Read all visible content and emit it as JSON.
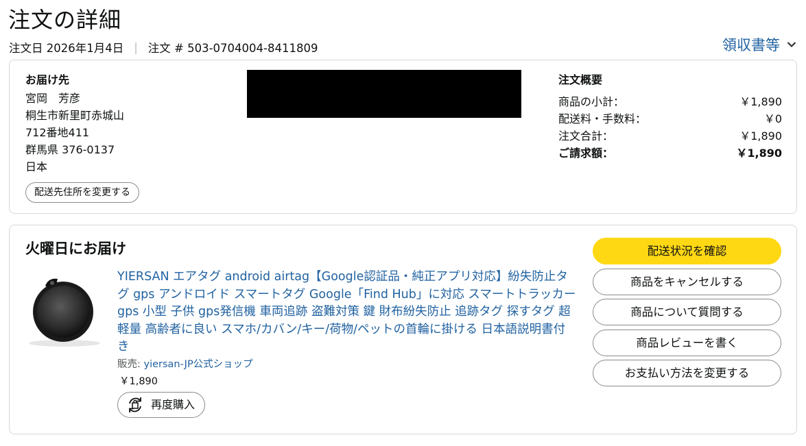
{
  "header": {
    "title": "注文の詳細",
    "order_date": "注文日 2026年1月4日",
    "separator": "|",
    "order_number": "注文 # 503-0704004-8411809",
    "receipt_link": "領収書等"
  },
  "shipping": {
    "heading": "お届け先",
    "lines": [
      "宮岡　芳彦",
      "桐生市新里町赤城山",
      "712番地411",
      "群馬県 376-0137",
      "日本"
    ],
    "change_button": "配送先住所を変更する"
  },
  "summary": {
    "heading": "注文概要",
    "rows": [
      {
        "label": "商品の小計：",
        "value": "￥1,890"
      },
      {
        "label": "配送料・手数料：",
        "value": "￥0"
      },
      {
        "label": "注文合計：",
        "value": "￥1,890"
      },
      {
        "label": "ご請求額：",
        "value": "￥1,890"
      }
    ]
  },
  "delivery": {
    "heading": "火曜日にお届け",
    "product_title": "YIERSAN エアタグ android airtag【Google認証品・純正アプリ対応】紛失防止タグ gps アンドロイド スマートタグ Google「Find Hub」に対応 スマートトラッカー gps 小型 子供 gps発信機 車両追跡 盗難対策 鍵 財布紛失防止 追跡タグ 探すタグ 超軽量 高齢者に良い スマホ/カバン/キー/荷物/ペットの首輪に掛ける 日本語説明書付き",
    "seller_label": "販売: ",
    "seller_name": "yiersan-JP公式ショップ",
    "price": "￥1,890",
    "rebuy_button": "再度購入"
  },
  "actions": [
    "配送状況を確認",
    "商品をキャンセルする",
    "商品について質問する",
    "商品レビューを書く",
    "お支払い方法を変更する"
  ],
  "colors": {
    "link": "#2162a1",
    "primary_button": "#ffd814",
    "border": "#d5d9d9"
  }
}
